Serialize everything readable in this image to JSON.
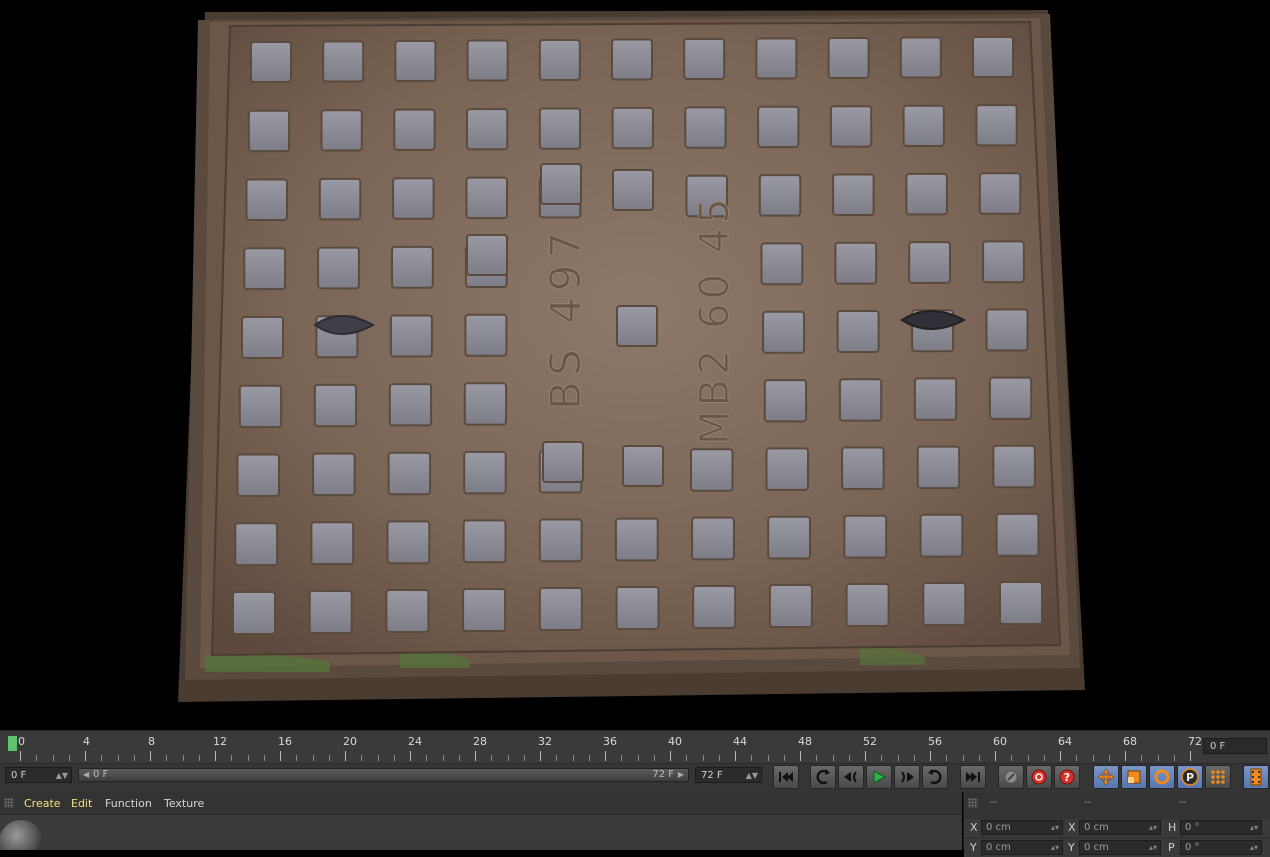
{
  "viewport": {
    "cover_texts": [
      "BS 497",
      "MB2 60 45"
    ],
    "grid_rows": 9,
    "grid_cols": 11
  },
  "timeline": {
    "ticks": [
      "0",
      "4",
      "8",
      "12",
      "16",
      "20",
      "24",
      "28",
      "32",
      "36",
      "40",
      "44",
      "48",
      "52",
      "56",
      "60",
      "64",
      "68",
      "72"
    ],
    "current_frame_right": "0 F",
    "playhead_color": "#5ec46d"
  },
  "transport": {
    "start_field": "0 F",
    "range_start": "0 F",
    "range_end": "72 F",
    "end_field": "72 F",
    "buttons": [
      {
        "name": "goto-start-button",
        "icon": "skip-to-start-icon"
      },
      {
        "name": "goto-prev-key-button",
        "icon": "prev-key-icon"
      },
      {
        "name": "step-back-button",
        "icon": "step-back-icon"
      },
      {
        "name": "play-button",
        "icon": "play-icon"
      },
      {
        "name": "step-forward-button",
        "icon": "step-forward-icon"
      },
      {
        "name": "goto-next-key-button",
        "icon": "next-key-icon"
      },
      {
        "name": "goto-end-button",
        "icon": "skip-to-end-icon"
      },
      {
        "name": "record-keys-button",
        "icon": "key-icon"
      },
      {
        "name": "autokey-button",
        "icon": "record-icon"
      },
      {
        "name": "help-button",
        "icon": "question-icon"
      },
      {
        "name": "move-tool-button",
        "icon": "move-icon"
      },
      {
        "name": "scale-tool-button",
        "icon": "scale-icon"
      },
      {
        "name": "rotate-tool-button",
        "icon": "rotate-icon"
      },
      {
        "name": "parameter-button",
        "icon": "p-icon"
      },
      {
        "name": "points-button",
        "icon": "grid-dots-icon"
      },
      {
        "name": "timeline-window-button",
        "icon": "film-icon"
      }
    ],
    "accent_orange": "#f08a1c",
    "accent_red": "#d9302a"
  },
  "menu": {
    "items": [
      "Create",
      "Edit",
      "Function",
      "Texture"
    ]
  },
  "coordinates": {
    "headers": [
      "--",
      "--",
      "--"
    ],
    "rows": [
      {
        "a_label": "X",
        "a_value": "0 cm",
        "b_label": "X",
        "b_value": "0 cm",
        "c_label": "H",
        "c_value": "0 °"
      },
      {
        "a_label": "Y",
        "a_value": "0 cm",
        "b_label": "Y",
        "b_value": "0 cm",
        "c_label": "P",
        "c_value": "0 °"
      }
    ]
  }
}
